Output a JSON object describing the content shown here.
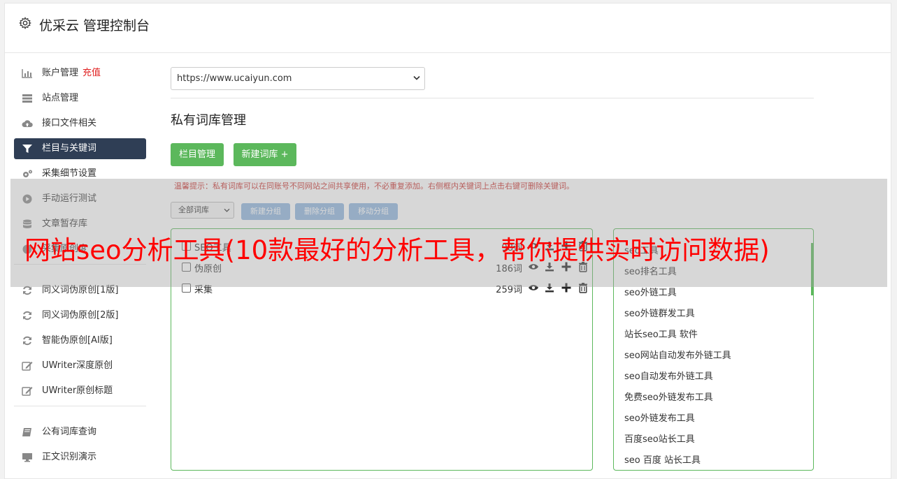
{
  "header": {
    "title": "优采云 管理控制台"
  },
  "sidebar": {
    "items": [
      {
        "label": "账户管理",
        "tag": "充值"
      },
      {
        "label": "站点管理"
      },
      {
        "label": "接口文件相关"
      },
      {
        "label": "栏目与关键词"
      },
      {
        "label": "采集细节设置"
      },
      {
        "label": "手动运行测试"
      },
      {
        "label": "文章暂存库"
      },
      {
        "label": "采集原创度"
      },
      {
        "label": "同义词伪原创[1版]"
      },
      {
        "label": "同义词伪原创[2版]"
      },
      {
        "label": "智能伪原创[AI版]"
      },
      {
        "label": "UWriter深度原创"
      },
      {
        "label": "UWriter原创标题"
      },
      {
        "label": "公有词库查询"
      },
      {
        "label": "正文识别演示"
      }
    ]
  },
  "site_select": {
    "value": "https://www.ucaiyun.com"
  },
  "page_title": "私有词库管理",
  "buttons": {
    "column_manage": "栏目管理",
    "new_library": "新建词库 +"
  },
  "tip": "温馨提示：私有词库可以在同账号不同网站之间共享使用，不必重复添加。右侧框内关键词上点击右键可删除关键词。",
  "group_select": {
    "value": "全部词库"
  },
  "group_buttons": {
    "new": "新建分组",
    "delete": "删除分组",
    "move": "移动分组"
  },
  "libraries": [
    {
      "name": "SEO工具",
      "count": "98词"
    },
    {
      "name": "伪原创",
      "count": "186词"
    },
    {
      "name": "采集",
      "count": "259词"
    }
  ],
  "keywords": [
    "seo工具",
    "seo排名工具",
    "seo外链工具",
    "seo外链群发工具",
    "站长seo工具 软件",
    "seo网站自动发布外链工具",
    "seo自动发布外链工具",
    "免费seo外链发布工具",
    "seo外链发布工具",
    "百度seo站长工具",
    "seo 百度 站长工具"
  ],
  "banner": {
    "text": "网站seo分析工具(10款最好的分析工具，帮你提供实时访问数据)"
  },
  "colors": {
    "active_nav": "#2f3e55",
    "green": "#5cb85c",
    "blue": "#8fb6df",
    "red": "#ff0000"
  },
  "icons": [
    "gear-icon",
    "bar-chart-icon",
    "server-icon",
    "cloud-upload-icon",
    "filter-icon",
    "cogs-icon",
    "play-icon",
    "database-icon",
    "refresh-icon",
    "edit-icon",
    "book-icon",
    "monitor-icon",
    "eye-icon",
    "download-icon",
    "plus-icon",
    "trash-icon"
  ]
}
